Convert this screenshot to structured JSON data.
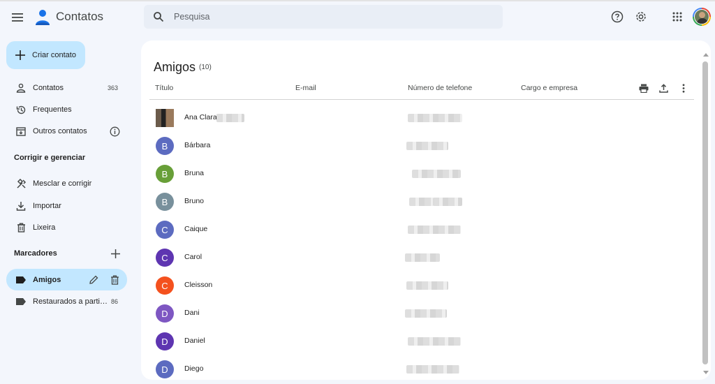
{
  "app": {
    "title": "Contatos"
  },
  "search": {
    "placeholder": "Pesquisa"
  },
  "header_icons": [
    "menu-icon",
    "help-icon",
    "settings-icon",
    "apps-icon",
    "account-avatar"
  ],
  "sidebar": {
    "create_label": "Criar contato",
    "items": [
      {
        "label": "Contatos",
        "count": "363",
        "icon": "person-icon"
      },
      {
        "label": "Frequentes",
        "icon": "history-icon"
      },
      {
        "label": "Outros contatos",
        "icon": "archive-icon",
        "trail_icon": "info-icon"
      }
    ],
    "section_manage": "Corrigir e gerenciar",
    "manage_items": [
      {
        "label": "Mesclar e corrigir",
        "icon": "merge-icon"
      },
      {
        "label": "Importar",
        "icon": "download-icon"
      },
      {
        "label": "Lixeira",
        "icon": "trash-icon"
      }
    ],
    "section_labels": "Marcadores",
    "labels": [
      {
        "label": "Amigos",
        "active": true
      },
      {
        "label": "Restaurados a parti…",
        "count": "86"
      }
    ]
  },
  "main": {
    "title": "Amigos",
    "count": "(10)",
    "columns": [
      "Título",
      "E-mail",
      "Número de telefone",
      "Cargo e empresa"
    ],
    "contacts": [
      {
        "name": "Ana Clara",
        "initial": "",
        "color": "",
        "photo": true
      },
      {
        "name": "Bárbara",
        "initial": "B",
        "color": "#5c6bc0"
      },
      {
        "name": "Bruna",
        "initial": "B",
        "color": "#689f38"
      },
      {
        "name": "Bruno",
        "initial": "B",
        "color": "#78909c"
      },
      {
        "name": "Caique",
        "initial": "C",
        "color": "#5c6bc0"
      },
      {
        "name": "Carol",
        "initial": "C",
        "color": "#5e35b1"
      },
      {
        "name": "Cleisson",
        "initial": "C",
        "color": "#f4511e"
      },
      {
        "name": "Dani",
        "initial": "D",
        "color": "#7e57c2"
      },
      {
        "name": "Daniel",
        "initial": "D",
        "color": "#5e35b1"
      },
      {
        "name": "Diego",
        "initial": "D",
        "color": "#5c6bc0"
      }
    ]
  },
  "colors": {
    "accent": "#c2e7ff",
    "background": "#f3f6fc",
    "search_bg": "#e9eef6"
  }
}
